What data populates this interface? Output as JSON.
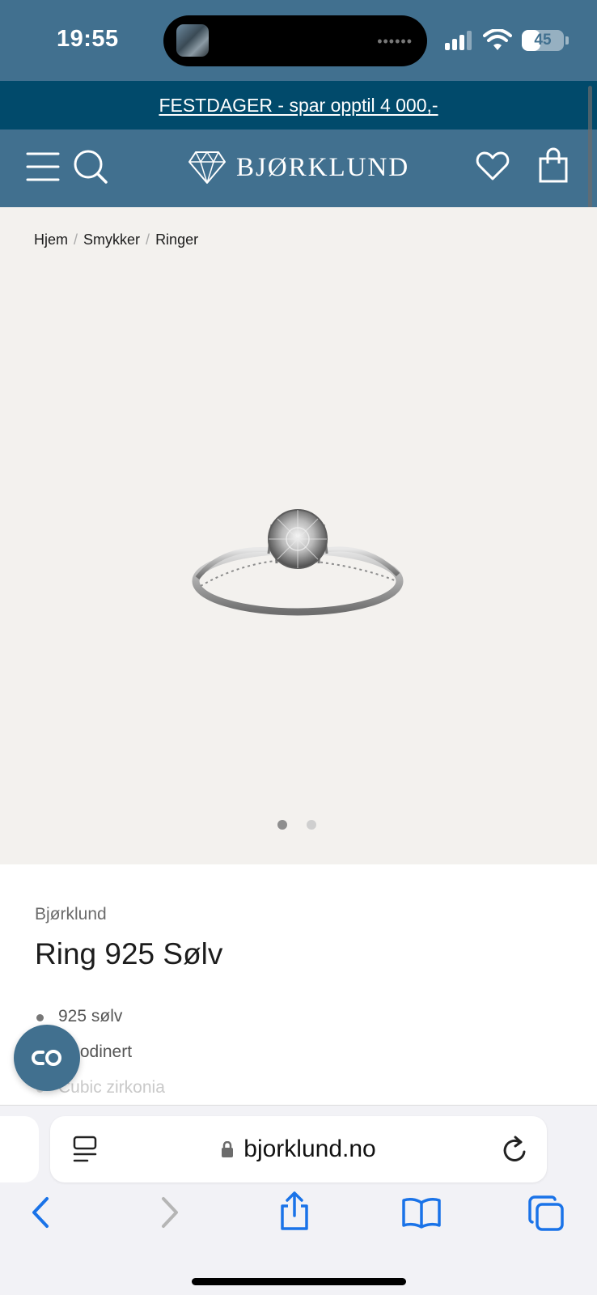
{
  "status_bar": {
    "time": "19:55",
    "battery": "45",
    "battery_level": 0.45,
    "icons": [
      "cellular-signal-icon",
      "wifi-icon",
      "battery-icon"
    ]
  },
  "promo": {
    "text": "FESTDAGER - spar opptil 4 000,-"
  },
  "header": {
    "logo_text": "BJØRKLUND",
    "icons": [
      "menu-icon",
      "search-icon",
      "diamond-logo-icon",
      "heart-icon",
      "shopping-bag-icon"
    ]
  },
  "breadcrumb": {
    "items": [
      "Hjem",
      "Smykker",
      "Ringer"
    ],
    "separator": "/"
  },
  "gallery": {
    "image_count": 2,
    "active_index": 0
  },
  "product": {
    "brand": "Bjørklund",
    "title": "Ring 925 Sølv",
    "features": [
      "925 sølv",
      "Rhodinert",
      "Cubic zirkonia"
    ]
  },
  "browser": {
    "url": "bjorklund.no",
    "icons": [
      "reader-icon",
      "lock-icon",
      "reload-icon",
      "back-icon",
      "forward-icon",
      "share-icon",
      "bookmarks-icon",
      "tabs-icon"
    ]
  },
  "colors": {
    "header_bg": "#41708f",
    "promo_bg": "#014a6b",
    "gallery_bg": "#f3f1ee",
    "safari_blue": "#1a73e8"
  }
}
